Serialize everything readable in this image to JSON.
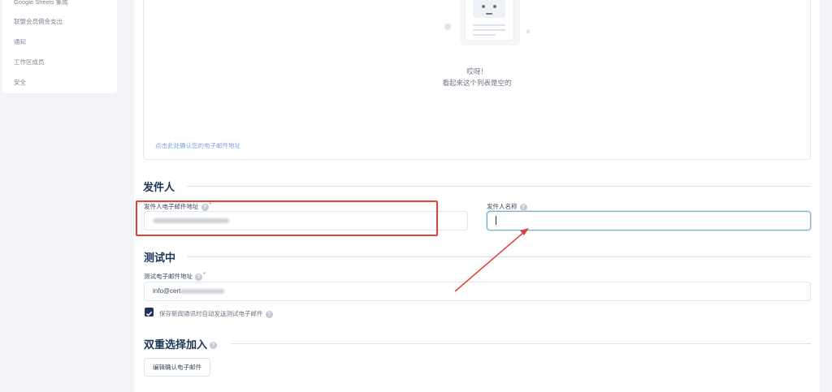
{
  "sidebar": {
    "items": [
      {
        "label": "Google Sheets 集成"
      },
      {
        "label": "联盟会员佣金支出"
      },
      {
        "label": "通知"
      },
      {
        "label": "工作区成员"
      },
      {
        "label": "安全"
      }
    ]
  },
  "empty_state": {
    "title": "哎呀！",
    "subtitle": "看起来这个列表是空的",
    "confirm_link": "点击此处确认您的电子邮件地址"
  },
  "sender": {
    "title": "发件人",
    "email_label": "发件人电子邮件地址",
    "name_label": "发件人名称",
    "name_value": ""
  },
  "testing": {
    "title": "测试中",
    "email_label": "测试电子邮件地址",
    "email_prefix": "info@cert",
    "auto_send_label": "保存新闻通讯时自动发送测试电子邮件",
    "auto_send_checked": true
  },
  "double_optin": {
    "title": "双重选择加入",
    "edit_button": "编辑确认电子邮件"
  },
  "colors": {
    "brand": "#1e3557",
    "highlight_box": "#e0403a",
    "focus": "#6fb1d9"
  }
}
